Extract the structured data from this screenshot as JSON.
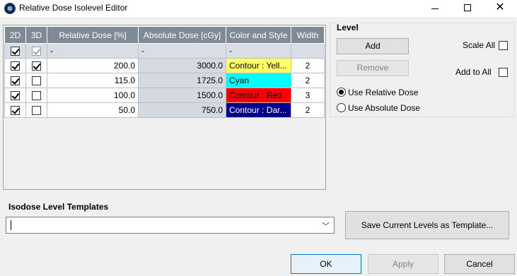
{
  "window": {
    "title": "Relative Dose Isolevel Editor"
  },
  "table": {
    "headers": [
      "2D",
      "3D",
      "Relative Dose [%]",
      "Absolute Dose [cGy]",
      "Color and Style",
      "Width"
    ],
    "rows": [
      {
        "d2": true,
        "d3": true,
        "d3_disabled": true,
        "relative": "-",
        "absolute": "-",
        "color_style": "-",
        "width": "",
        "color": "#d9dde4",
        "text_color": "#000000"
      },
      {
        "d2": true,
        "d3": true,
        "d3_disabled": false,
        "relative": "200.0",
        "absolute": "3000.0",
        "color_style": "Contour : Yell...",
        "width": "2",
        "color": "#ffff66",
        "text_color": "#000000"
      },
      {
        "d2": true,
        "d3": false,
        "d3_disabled": false,
        "relative": "115.0",
        "absolute": "1725.0",
        "color_style": "Cyan",
        "width": "2",
        "color": "#00ffff",
        "text_color": "#000000"
      },
      {
        "d2": true,
        "d3": false,
        "d3_disabled": false,
        "relative": "100.0",
        "absolute": "1500.0",
        "color_style": "Contour : Red",
        "width": "3",
        "color": "#ff0000",
        "text_color": "#000000"
      },
      {
        "d2": true,
        "d3": false,
        "d3_disabled": false,
        "relative": "50.0",
        "absolute": "750.0",
        "color_style": "Contour : Dar...",
        "width": "2",
        "color": "#00008b",
        "text_color": "#ffffff"
      }
    ]
  },
  "level": {
    "title": "Level",
    "add_label": "Add",
    "remove_label": "Remove",
    "scale_all_label": "Scale All",
    "scale_all_checked": false,
    "add_to_all_label": "Add to All",
    "add_to_all_checked": false,
    "use_relative_label": "Use Relative Dose",
    "use_absolute_label": "Use Absolute Dose",
    "selected": "relative"
  },
  "templates": {
    "label": "Isodose Level Templates",
    "value": "",
    "save_label": "Save Current Levels as Template..."
  },
  "footer": {
    "ok_label": "OK",
    "apply_label": "Apply",
    "cancel_label": "Cancel"
  }
}
